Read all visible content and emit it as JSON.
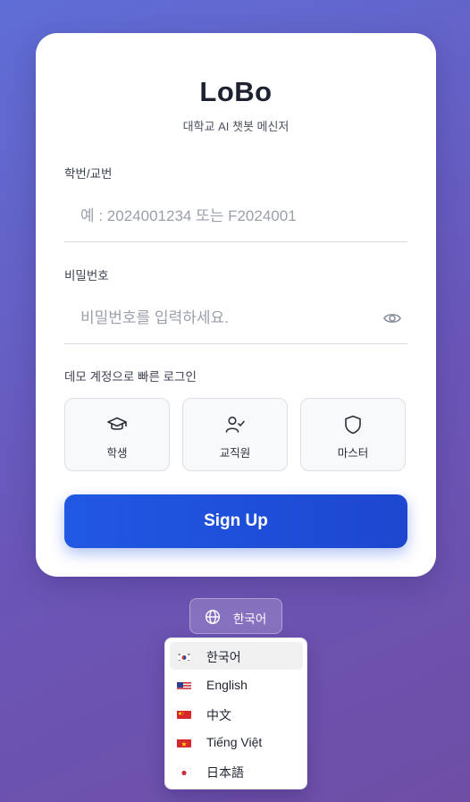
{
  "app": {
    "title": "LoBo",
    "subtitle": "대학교 AI 챗봇 메신저"
  },
  "form": {
    "id_label": "학번/교번",
    "id_placeholder": "예 : 2024001234 또는 F2024001",
    "id_value": "",
    "password_label": "비밀번호",
    "password_placeholder": "비밀번호를 입력하세요.",
    "password_value": "",
    "password_toggle_icon": "eye-icon"
  },
  "demo": {
    "label": "데모 계정으로 빠른 로그인",
    "accounts": [
      {
        "label": "학생",
        "icon": "graduation-cap-icon"
      },
      {
        "label": "교직원",
        "icon": "user-check-icon"
      },
      {
        "label": "마스터",
        "icon": "shield-icon"
      }
    ]
  },
  "submit": {
    "label": "Sign Up"
  },
  "language": {
    "current": "한국어",
    "icon": "globe-icon",
    "options": [
      {
        "label": "한국어",
        "flag": "kr-flag",
        "selected": true
      },
      {
        "label": "English",
        "flag": "us-flag",
        "selected": false
      },
      {
        "label": "中文",
        "flag": "cn-flag",
        "selected": false
      },
      {
        "label": "Tiếng Việt",
        "flag": "vn-flag",
        "selected": false
      },
      {
        "label": "日本語",
        "flag": "jp-flag",
        "selected": false
      }
    ]
  },
  "colors": {
    "background_start": "#5f6ed6",
    "background_end": "#6f4ea6",
    "primary": "#1d4ed8",
    "card": "#ffffff"
  }
}
